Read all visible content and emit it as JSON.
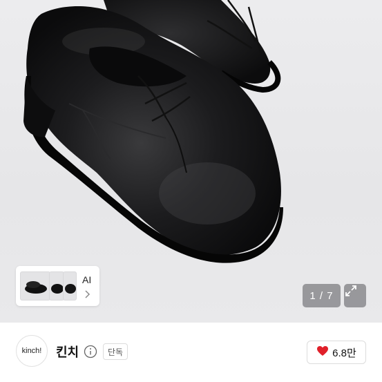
{
  "gallery": {
    "ai_label": "AI",
    "counter": "1 / 7"
  },
  "seller": {
    "avatar_text": "kinch!",
    "name": "킨치",
    "badge": "단독",
    "likes": "6.8만"
  },
  "icons": {
    "ai_chevron": "chevron-right-icon",
    "expand": "expand-arrows-icon",
    "info": "info-icon",
    "heart": "heart-icon"
  },
  "colors": {
    "heart": "#e0202a",
    "counter_bg": "#78787d"
  }
}
